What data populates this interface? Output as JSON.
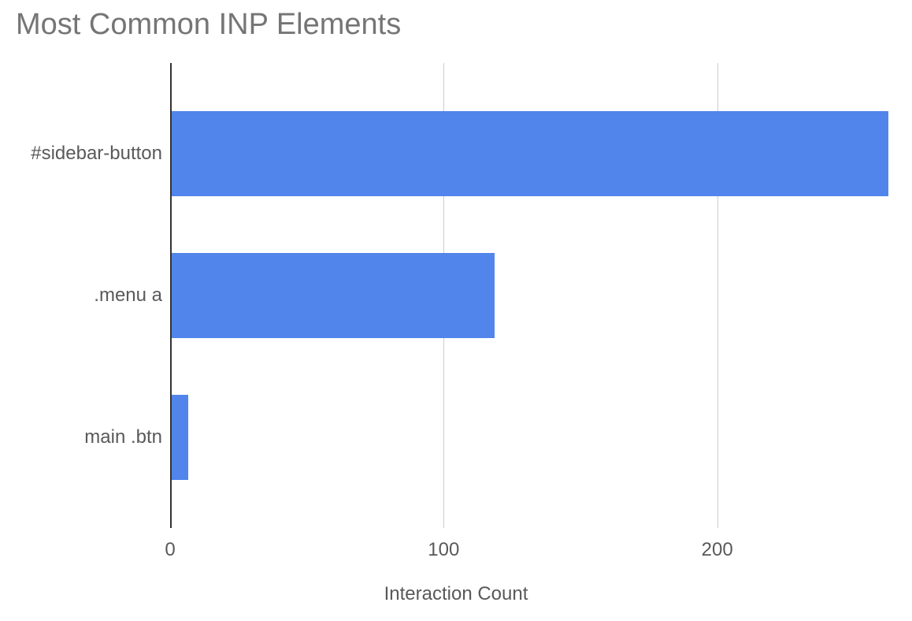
{
  "chart_data": {
    "type": "bar",
    "orientation": "horizontal",
    "title": "Most Common INP Elements",
    "xlabel": "Interaction Count",
    "ylabel": "",
    "categories": [
      "#sidebar-button",
      ".menu a",
      "main .btn"
    ],
    "values": [
      262,
      118,
      6
    ],
    "xlim": [
      0,
      262
    ],
    "xticks": [
      0,
      100,
      200
    ],
    "bar_color": "#5185ec",
    "grid_color": "#cccccc"
  }
}
